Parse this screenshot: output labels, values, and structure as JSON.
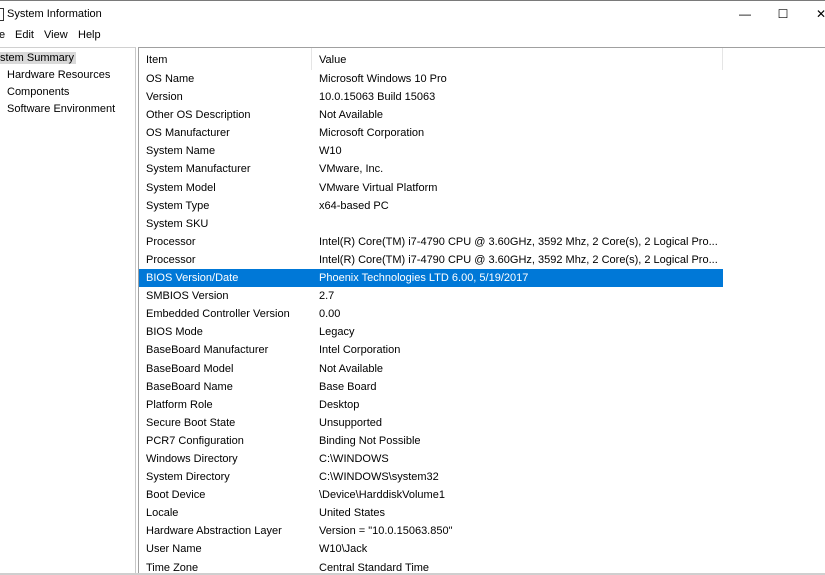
{
  "window": {
    "title": "System Information",
    "minimize": "—",
    "maximize": "☐",
    "close": "✕"
  },
  "menu": [
    "e",
    "Edit",
    "View",
    "Help"
  ],
  "tree": [
    {
      "label": "stem Summary",
      "expander": ""
    },
    {
      "label": "Hardware Resources",
      "expander": "-"
    },
    {
      "label": "Components",
      "expander": "-"
    },
    {
      "label": "Software Environment",
      "expander": "-"
    }
  ],
  "table": {
    "columns": [
      "Item",
      "Value"
    ],
    "rows": [
      [
        "OS Name",
        "Microsoft Windows 10 Pro"
      ],
      [
        "Version",
        "10.0.15063 Build 15063"
      ],
      [
        "Other OS Description",
        "Not Available"
      ],
      [
        "OS Manufacturer",
        "Microsoft Corporation"
      ],
      [
        "System Name",
        "W10"
      ],
      [
        "System Manufacturer",
        "VMware, Inc."
      ],
      [
        "System Model",
        "VMware Virtual Platform"
      ],
      [
        "System Type",
        "x64-based PC"
      ],
      [
        "System SKU",
        ""
      ],
      [
        "Processor",
        "Intel(R) Core(TM) i7-4790 CPU @ 3.60GHz, 3592 Mhz, 2 Core(s), 2 Logical Pro..."
      ],
      [
        "Processor",
        "Intel(R) Core(TM) i7-4790 CPU @ 3.60GHz, 3592 Mhz, 2 Core(s), 2 Logical Pro..."
      ],
      [
        "BIOS Version/Date",
        "Phoenix Technologies LTD 6.00, 5/19/2017"
      ],
      [
        "SMBIOS Version",
        "2.7"
      ],
      [
        "Embedded Controller Version",
        "0.00"
      ],
      [
        "BIOS Mode",
        "Legacy"
      ],
      [
        "BaseBoard Manufacturer",
        "Intel Corporation"
      ],
      [
        "BaseBoard Model",
        "Not Available"
      ],
      [
        "BaseBoard Name",
        "Base Board"
      ],
      [
        "Platform Role",
        "Desktop"
      ],
      [
        "Secure Boot State",
        "Unsupported"
      ],
      [
        "PCR7 Configuration",
        "Binding Not Possible"
      ],
      [
        "Windows Directory",
        "C:\\WINDOWS"
      ],
      [
        "System Directory",
        "C:\\WINDOWS\\system32"
      ],
      [
        "Boot Device",
        "\\Device\\HarddiskVolume1"
      ],
      [
        "Locale",
        "United States"
      ],
      [
        "Hardware Abstraction Layer",
        "Version = \"10.0.15063.850\""
      ],
      [
        "User Name",
        "W10\\Jack"
      ],
      [
        "Time Zone",
        "Central Standard Time"
      ]
    ],
    "selected_row": 11
  },
  "colors": {
    "selection": "#0078d7",
    "tree_selection": "#d9d9d9"
  }
}
